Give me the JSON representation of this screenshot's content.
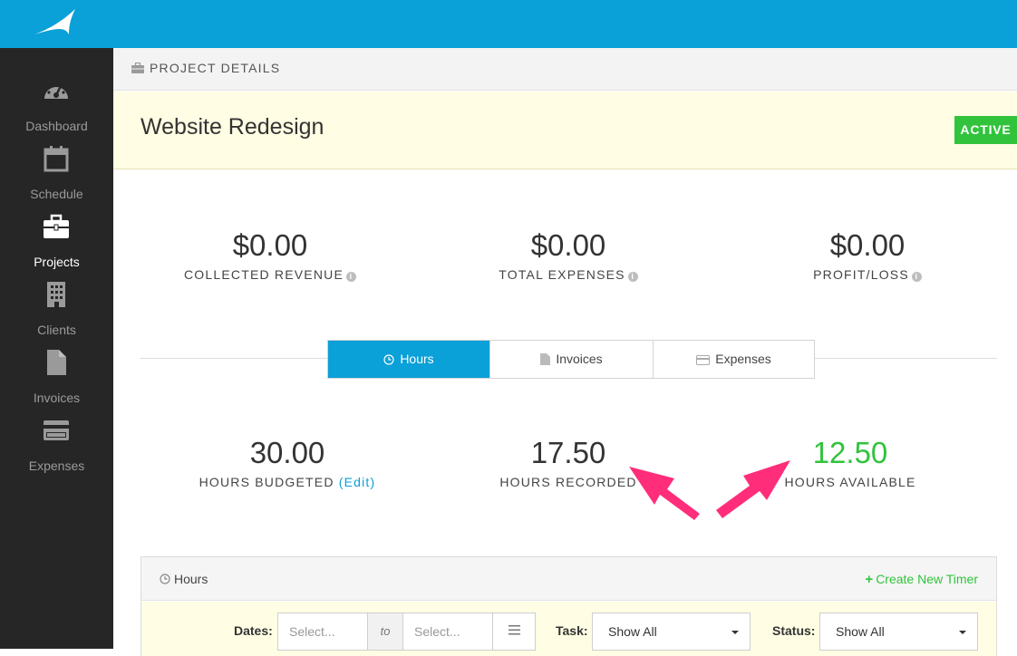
{
  "app": {
    "brand_color": "#0aa0d8",
    "logo_icon": "swoosh-logo-icon"
  },
  "sidebar": {
    "items": [
      {
        "label": "Dashboard",
        "icon": "dashboard-gauge-icon"
      },
      {
        "label": "Schedule",
        "icon": "calendar-icon"
      },
      {
        "label": "Projects",
        "icon": "briefcase-icon",
        "active": true
      },
      {
        "label": "Clients",
        "icon": "building-icon"
      },
      {
        "label": "Invoices",
        "icon": "document-icon"
      },
      {
        "label": "Expenses",
        "icon": "credit-card-icon"
      }
    ]
  },
  "page_header": {
    "title": "PROJECT DETAILS",
    "icon": "briefcase-icon"
  },
  "project": {
    "name": "Website Redesign",
    "status": "ACTIVE",
    "status_color": "#32c33c"
  },
  "financials": [
    {
      "value": "$0.00",
      "label": "COLLECTED REVENUE"
    },
    {
      "value": "$0.00",
      "label": "TOTAL EXPENSES"
    },
    {
      "value": "$0.00",
      "label": "PROFIT/LOSS"
    }
  ],
  "tabs": [
    {
      "label": "Hours",
      "icon": "clock-icon",
      "active": true
    },
    {
      "label": "Invoices",
      "icon": "document-icon"
    },
    {
      "label": "Expenses",
      "icon": "credit-card-icon"
    }
  ],
  "hours": {
    "budgeted": {
      "value": "30.00",
      "label": "HOURS BUDGETED",
      "edit_label": "(Edit)"
    },
    "recorded": {
      "value": "17.50",
      "label": "HOURS RECORDED"
    },
    "available": {
      "value": "12.50",
      "label": "HOURS AVAILABLE",
      "color": "#32c33c"
    }
  },
  "annotation": {
    "arrow_color": "#ff2d7a"
  },
  "hours_panel": {
    "title": "Hours",
    "create_timer_label": "Create New Timer",
    "filters": {
      "dates_label": "Dates:",
      "from_placeholder": "Select...",
      "to_label": "to",
      "to_placeholder": "Select...",
      "task_label": "Task:",
      "task_value": "Show All",
      "status_label": "Status:",
      "status_value": "Show All"
    }
  }
}
